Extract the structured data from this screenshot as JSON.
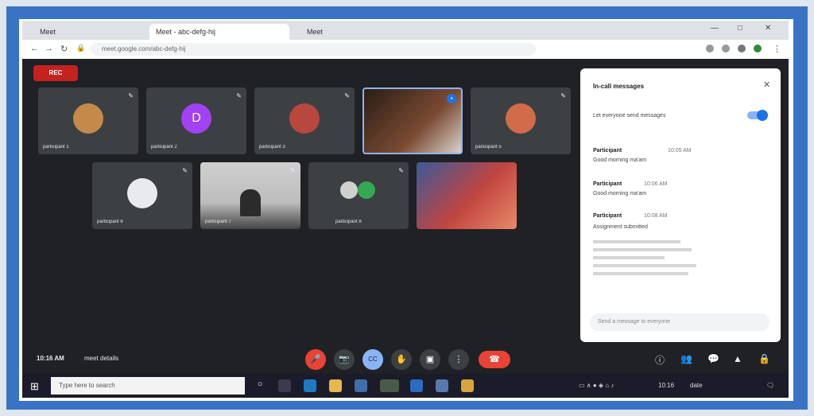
{
  "browser": {
    "tabs": [
      "Meet",
      "Meet - abc-defg-hij",
      "Meet"
    ],
    "url": "meet.google.com/abc-defg-hij",
    "window_controls": [
      "—",
      "□",
      "✕"
    ]
  },
  "meeting": {
    "rec_label": "REC",
    "clock": "10:16 AM",
    "meeting_label": "meet details",
    "row1": [
      {
        "name": "participant 1",
        "avatar": "photo",
        "color": "#c58a4a"
      },
      {
        "name": "participant 2",
        "avatar": "D",
        "color": "#a142f4"
      },
      {
        "name": "participant 3",
        "avatar": "photo",
        "color": "#b8483f"
      },
      {
        "name": "",
        "avatar": "video",
        "color": "#5a3a2a"
      },
      {
        "name": "participant 5",
        "avatar": "photo",
        "color": "#d26b4a"
      }
    ],
    "row2": [
      {
        "name": "participant 6",
        "avatar": "circle",
        "color": "#e8eaed"
      },
      {
        "name": "participant 7",
        "avatar": "video",
        "color": "#6a6a6a"
      },
      {
        "name": "participant 8",
        "avatar": "group",
        "color": "#34a853"
      },
      {
        "name": "",
        "avatar": "video",
        "color": "#c2453f"
      }
    ]
  },
  "chat": {
    "title": "In-call messages",
    "toggle_label": "Let everyone send messages",
    "messages": [
      {
        "author": "Participant",
        "time": "10:05 AM",
        "text": "Good morning ma'am"
      },
      {
        "author": "Participant",
        "time": "10:06 AM",
        "text": "Good morning ma'am"
      },
      {
        "author": "Participant",
        "time": "10:08 AM",
        "text": "Assignment submitted"
      }
    ],
    "input_placeholder": "Send a message to everyone"
  },
  "controls": {
    "mic": "🎤",
    "cam": "📷",
    "cc": "CC",
    "hand": "✋",
    "present": "▣",
    "more": "⋮",
    "leave": "☎"
  },
  "taskbar": {
    "search_placeholder": "Type here to search",
    "time": "10:16",
    "date": "date"
  }
}
